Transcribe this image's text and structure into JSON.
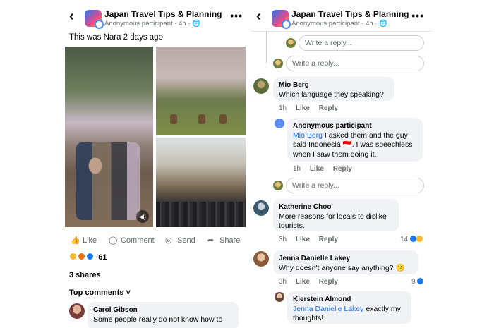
{
  "left": {
    "header": {
      "title": "Japan Travel Tips & Planning",
      "subtitle": "Anonymous participant · 4h · 🌐",
      "back_icon": "chevron-left-icon",
      "more_icon": "more-dots-icon"
    },
    "post_text": "This was Nara 2 days ago",
    "actions": {
      "like": "Like",
      "comment": "Comment",
      "send": "Send",
      "share": "Share"
    },
    "reaction_count": "61",
    "shares": "3 shares",
    "top_comments": "Top comments ˅",
    "comment": {
      "name": "Carol Gibson",
      "text": "Some people really do not know how to"
    }
  },
  "right": {
    "header": {
      "title": "Japan Travel Tips & Planning",
      "subtitle": "Anonymous participant · 4h · 🌐",
      "back_icon": "chevron-left-icon",
      "more_icon": "more-dots-icon"
    },
    "reply_placeholder": "Write a reply...",
    "comments": [
      {
        "name": "Mio Berg",
        "text": "Which language they speaking?",
        "time": "1h",
        "like": "Like",
        "reply": "Reply"
      },
      {
        "name": "Anonymous participant",
        "mention": "Mio Berg",
        "text": " I asked them and the guy said Indonesia 🇮🇩. I was speechless when I saw them doing it.",
        "time": "1h",
        "like": "Like",
        "reply": "Reply"
      },
      {
        "name": "Katherine Choo",
        "text": "More reasons for locals to dislike tourists.",
        "time": "3h",
        "like": "Like",
        "reply": "Reply",
        "count": "14"
      },
      {
        "name": "Jenna Danielle Lakey",
        "text": "Why doesn't anyone say anything? 😕",
        "time": "3h",
        "like": "Like",
        "reply": "Reply",
        "count": "9"
      },
      {
        "name": "Kierstein Almond",
        "mention": "Jenna Danielle Lakey",
        "text": " exactly my thoughts!"
      }
    ]
  },
  "colors": {
    "link": "#216fdb",
    "muted": "#65676b",
    "bubble": "#f0f2f5",
    "like_blue": "#1877f2"
  }
}
